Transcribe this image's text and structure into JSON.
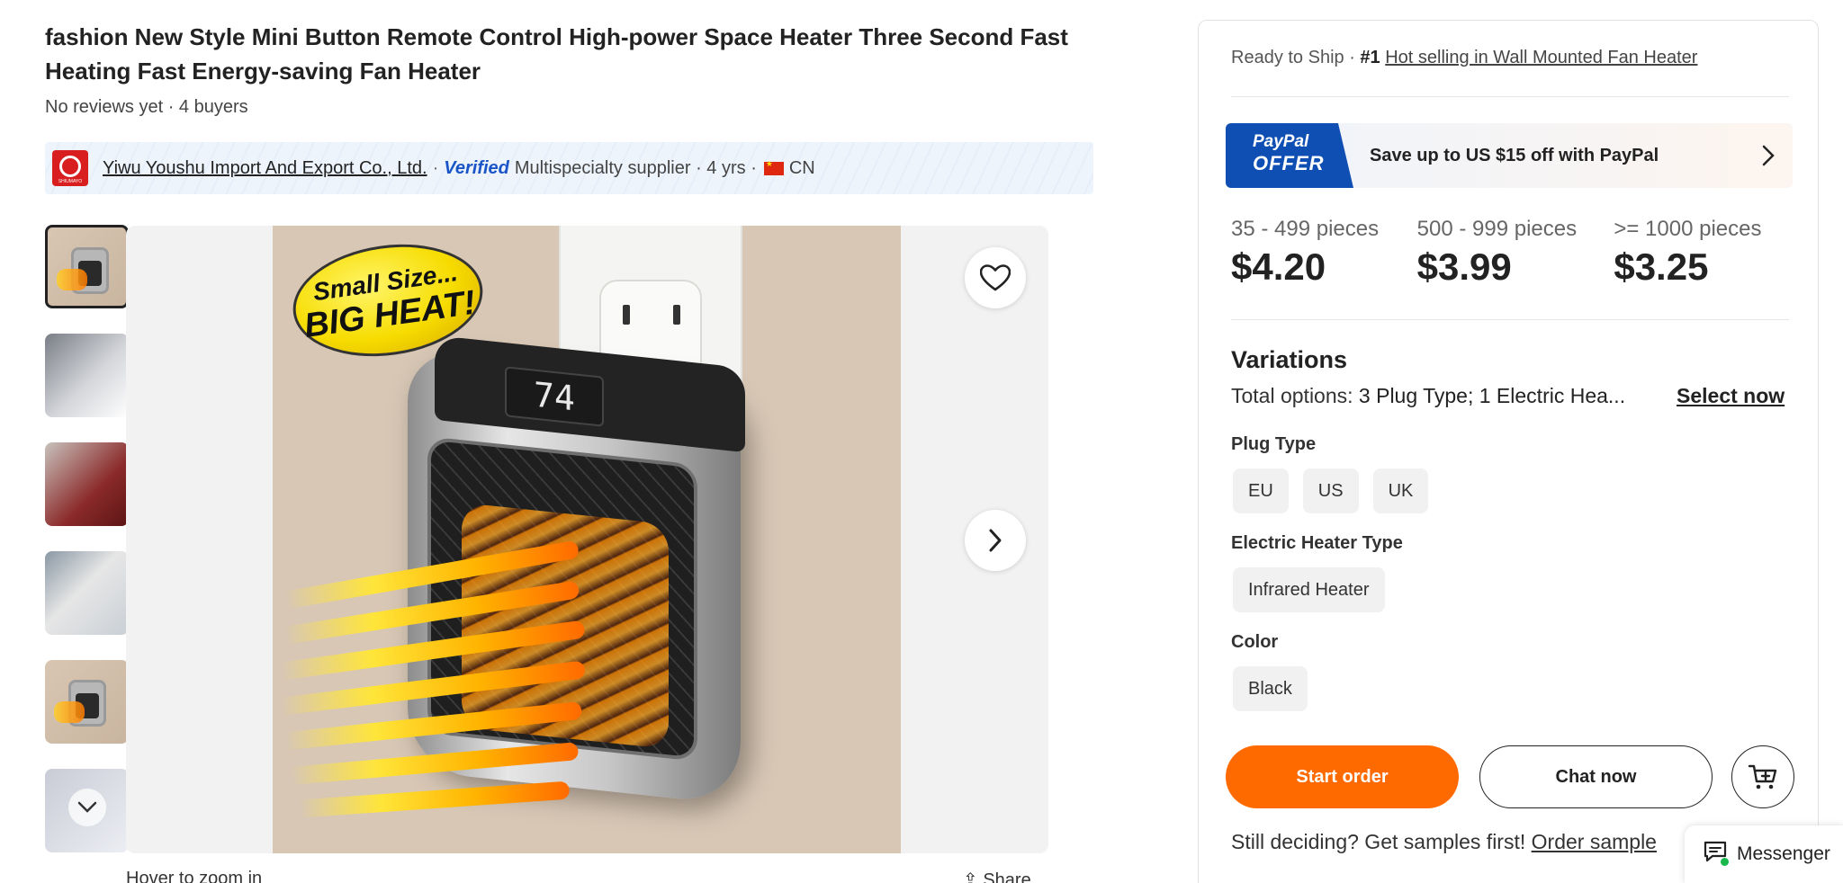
{
  "product": {
    "title": "fashion New Style Mini Button Remote Control High-power Space Heater Three Second Fast Heating Fast Energy-saving Fan Heater",
    "reviews": "No reviews yet · 4 buyers"
  },
  "supplier": {
    "logo_text": "SHIUMAYO",
    "name": "Yiwu Youshu Import And Export Co., Ltd.",
    "verified": "Verified",
    "details": "Multispecialty supplier · 4 yrs ·",
    "country": "CN"
  },
  "gallery": {
    "badge_line1": "Small Size...",
    "badge_line2": "BIG HEAT!",
    "display_value": "74",
    "below_text": "Hover to zoom in",
    "share_text": "Share"
  },
  "panel": {
    "ready_prefix": "Ready to Ship ·",
    "rank": "#1",
    "rank_link": "Hot selling in Wall Mounted Fan Heater",
    "paypal_tag1": "PayPal",
    "paypal_tag2": "OFFER",
    "paypal_text": "Save up to US $15 off with PayPal",
    "tiers": [
      {
        "qty": "35 - 499 pieces",
        "price": "$4.20"
      },
      {
        "qty": "500 - 999 pieces",
        "price": "$3.99"
      },
      {
        "qty": ">= 1000 pieces",
        "price": "$3.25"
      }
    ],
    "variations_title": "Variations",
    "total_options_label": "Total options:",
    "total_options_value": "3 Plug Type; 1 Electric Hea...",
    "select_now": "Select now",
    "plug_type_label": "Plug Type",
    "plug_types": [
      "EU",
      "US",
      "UK"
    ],
    "heater_type_label": "Electric Heater Type",
    "heater_types": [
      "Infrared Heater"
    ],
    "color_label": "Color",
    "colors": [
      "Black"
    ],
    "start_order": "Start order",
    "chat_now": "Chat now",
    "samples_text": "Still deciding? Get samples first!",
    "samples_link": "Order sample"
  },
  "messenger": {
    "label": "Messenger"
  },
  "colors": {
    "accent": "#ff6a00",
    "paypal": "#0f4fb4",
    "online": "#18b84a"
  },
  "icons": [
    "heart-icon",
    "chevron-right-icon",
    "chevron-down-icon",
    "cart-plus-icon",
    "message-icon",
    "share-icon"
  ]
}
